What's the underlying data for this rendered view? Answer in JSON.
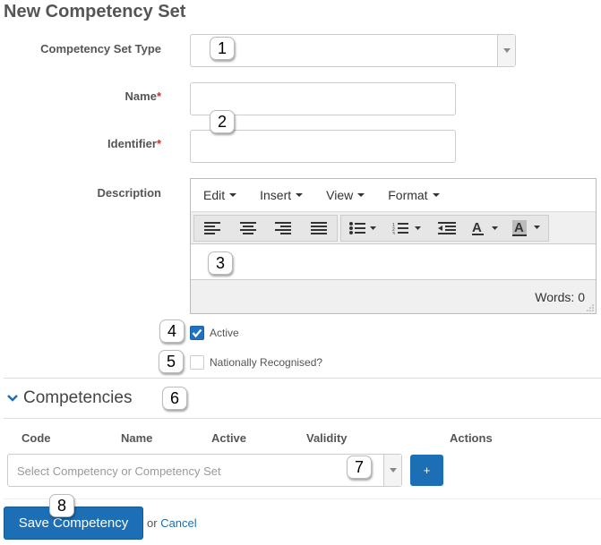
{
  "page": {
    "title": "New Competency Set"
  },
  "form": {
    "type_label": "Competency Set Type",
    "type_value": "",
    "name_label": "Name",
    "name_value": "",
    "identifier_label": "Identifier",
    "identifier_value": "",
    "required_mark": "*",
    "description_label": "Description"
  },
  "editor": {
    "menus": [
      "Edit",
      "Insert",
      "View",
      "Format"
    ],
    "content": "",
    "word_count_label": "Words: 0"
  },
  "checkboxes": {
    "active": {
      "label": "Active",
      "checked": true
    },
    "national": {
      "label": "Nationally Recognised?",
      "checked": false
    }
  },
  "competencies": {
    "title": "Competencies",
    "columns": [
      "Code",
      "Name",
      "Active",
      "Validity",
      "Actions"
    ],
    "select_placeholder": "Select Competency or Competency Set",
    "add_label": "+"
  },
  "footer": {
    "save_label": "Save Competency",
    "or_text": "or",
    "cancel_label": "Cancel"
  },
  "callouts": [
    "1",
    "2",
    "3",
    "4",
    "5",
    "6",
    "7",
    "8"
  ],
  "colors": {
    "primary": "#1c6fb5",
    "required": "#c9302c",
    "checkbox_checked": "#1e72c0"
  }
}
